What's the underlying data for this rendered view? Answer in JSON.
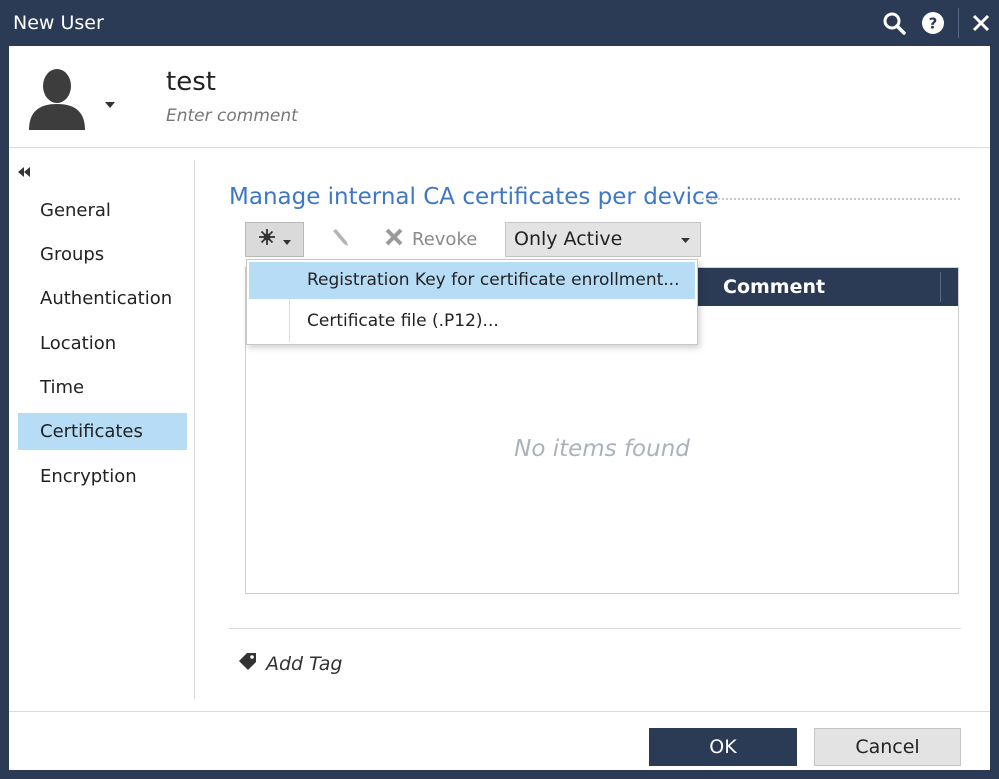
{
  "window": {
    "title": "New User"
  },
  "header": {
    "user_name": "test",
    "comment_placeholder": "Enter comment"
  },
  "sidebar": {
    "items": [
      {
        "label": "General"
      },
      {
        "label": "Groups"
      },
      {
        "label": "Authentication"
      },
      {
        "label": "Location"
      },
      {
        "label": "Time"
      },
      {
        "label": "Certificates",
        "active": true
      },
      {
        "label": "Encryption"
      }
    ]
  },
  "main": {
    "section_title": "Manage internal CA certificates per device",
    "toolbar": {
      "revoke_label": "Revoke",
      "filter_value": "Only Active"
    },
    "add_menu": {
      "items": [
        {
          "label": "Registration Key for certificate enrollment..."
        },
        {
          "label": "Certificate file (.P12)..."
        }
      ]
    },
    "grid": {
      "columns": [
        "Comment"
      ],
      "empty_message": "No items found"
    },
    "add_tag_label": "Add Tag"
  },
  "footer": {
    "ok_label": "OK",
    "cancel_label": "Cancel"
  },
  "colors": {
    "titlebar": "#2b3a55",
    "accent_title": "#3e78c5",
    "selection": "#b7dcf6"
  },
  "icons": [
    "search-icon",
    "help-icon",
    "close-icon",
    "user-avatar-icon",
    "collapse-icon",
    "add-icon",
    "edit-icon",
    "revoke-icon",
    "tag-icon"
  ]
}
